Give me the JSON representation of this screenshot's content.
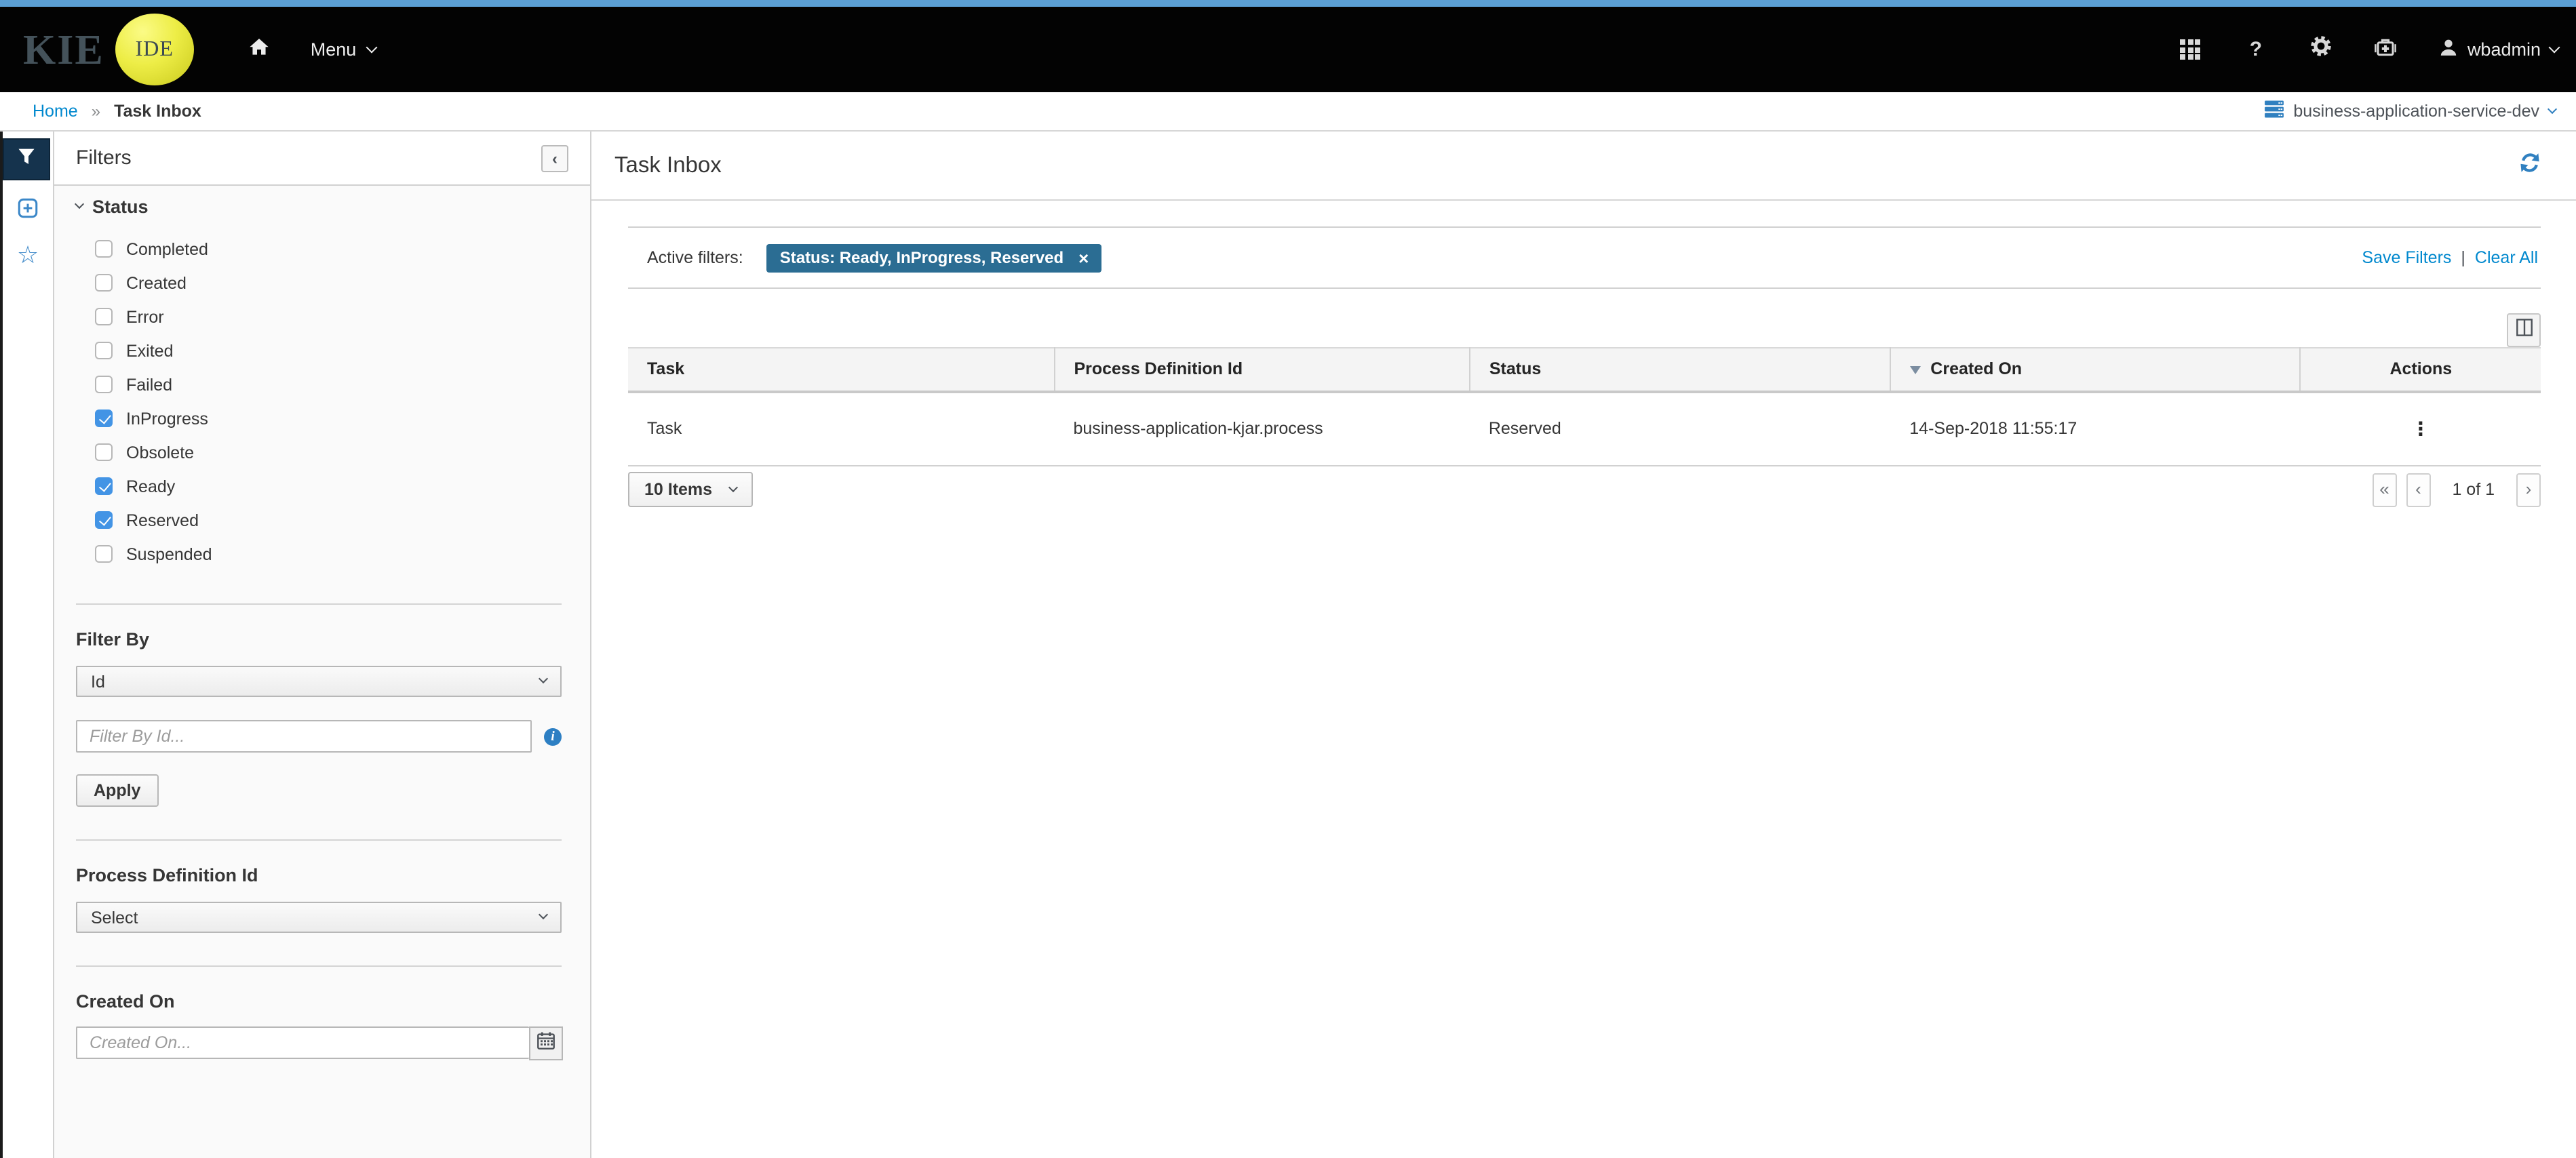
{
  "colors": {
    "accent_blue": "#0088ce",
    "badge_blue": "#2b6d93",
    "checkbox_blue": "#4394e5",
    "navbar_bg": "#030303",
    "top_strip_blue": "#5b9fd4",
    "rail_active_bg": "#15334d",
    "logo_yellow": "#eded46"
  },
  "navbar": {
    "logo_kie": "KIE",
    "logo_ide": "IDE",
    "menu_label": "Menu",
    "help_label": "?",
    "username": "wbadmin"
  },
  "breadcrumb": {
    "home": "Home",
    "separator": "»",
    "current": "Task Inbox",
    "server_name": "business-application-service-dev"
  },
  "filters": {
    "title": "Filters",
    "collapse_glyph": "‹",
    "status": {
      "title": "Status",
      "options": [
        {
          "label": "Completed",
          "checked": false
        },
        {
          "label": "Created",
          "checked": false
        },
        {
          "label": "Error",
          "checked": false
        },
        {
          "label": "Exited",
          "checked": false
        },
        {
          "label": "Failed",
          "checked": false
        },
        {
          "label": "InProgress",
          "checked": true
        },
        {
          "label": "Obsolete",
          "checked": false
        },
        {
          "label": "Ready",
          "checked": true
        },
        {
          "label": "Reserved",
          "checked": true
        },
        {
          "label": "Suspended",
          "checked": false
        }
      ]
    },
    "filter_by": {
      "title": "Filter By",
      "selected": "Id",
      "placeholder": "Filter By Id...",
      "info_glyph": "i",
      "apply_label": "Apply"
    },
    "process_definition": {
      "title": "Process Definition Id",
      "selected": "Select"
    },
    "created_on": {
      "title": "Created On",
      "placeholder": "Created On..."
    }
  },
  "main": {
    "title": "Task Inbox",
    "active_filters": {
      "label": "Active filters:",
      "badge": "Status: Ready, InProgress, Reserved",
      "badge_close": "×",
      "save_filters": "Save Filters",
      "separator": "|",
      "clear_all": "Clear All"
    },
    "table": {
      "columns": [
        "Task",
        "Process Definition Id",
        "Status",
        "Created On",
        "Actions"
      ],
      "sorted_column": "Created On",
      "sort_direction": "desc",
      "rows": [
        {
          "task": "Task",
          "process_definition_id": "business-application-kjar.process",
          "status": "Reserved",
          "created_on": "14-Sep-2018 11:55:17",
          "actions_glyph": "⋮"
        }
      ]
    },
    "pagination": {
      "page_size": "10 Items",
      "first": "«",
      "prev": "‹",
      "info": "1 of 1",
      "next": "›"
    }
  }
}
